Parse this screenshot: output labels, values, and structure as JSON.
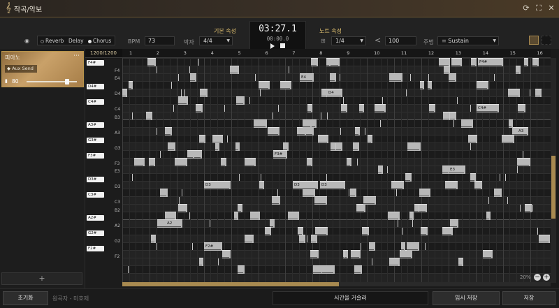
{
  "app": {
    "title": "작곡/악보"
  },
  "toolbar": {
    "effects": [
      {
        "label": "Reverb",
        "selected": false
      },
      {
        "label": "Delay",
        "selected": false
      },
      {
        "label": "Chorus",
        "selected": true
      }
    ],
    "bpm_label": "BPM",
    "bpm_value": "73",
    "meter_label": "박자",
    "meter_value": "4/4",
    "basic_props_title": "기본 속성",
    "note_props_title": "노트 속성",
    "note_length_value": "1/4",
    "velocity_value": "100",
    "technique_label": "주법",
    "technique_value": "Sustain"
  },
  "transport": {
    "time": "03:27.1",
    "sub_time": "00:00.0"
  },
  "track": {
    "name": "피아노",
    "aux_label": "Aux Send",
    "volume": "80",
    "volume_level": 0.8,
    "add_label": "+"
  },
  "ruler": {
    "position": "1200/1200",
    "bars": [
      "1",
      "2",
      "3",
      "4",
      "5",
      "6",
      "7",
      "8",
      "9",
      "10",
      "11",
      "12",
      "13",
      "14",
      "15",
      "16"
    ]
  },
  "keyboard": {
    "white_labels": [
      "F4",
      "E4",
      "D4",
      "C4",
      "B3",
      "A3",
      "G3",
      "F3",
      "E3",
      "D3",
      "C3",
      "B2",
      "A2",
      "G2",
      "F2"
    ],
    "black_labels": [
      "F4#",
      "D4#",
      "C4#",
      "A3#",
      "G3#",
      "F3#",
      "D3#",
      "C3#",
      "A2#",
      "G2#",
      "F2#"
    ]
  },
  "note_labels": [
    "F4#",
    "C4#",
    "E4",
    "D4",
    "A3",
    "F3#",
    "E3",
    "D3",
    "D3",
    "D3",
    "A2",
    "F2#"
  ],
  "zoom": {
    "value": "20%",
    "minus": "−",
    "plus": "+"
  },
  "footer": {
    "reset_label": "초기화",
    "composer_text": "원곡자 - 미호제",
    "timeline_label": "시간을 거슬러",
    "temp_save_label": "임시 저장",
    "save_label": "저장"
  },
  "colors": {
    "accent": "#e0c070",
    "gold": "#a88a50",
    "note": "#b8b8b8"
  }
}
